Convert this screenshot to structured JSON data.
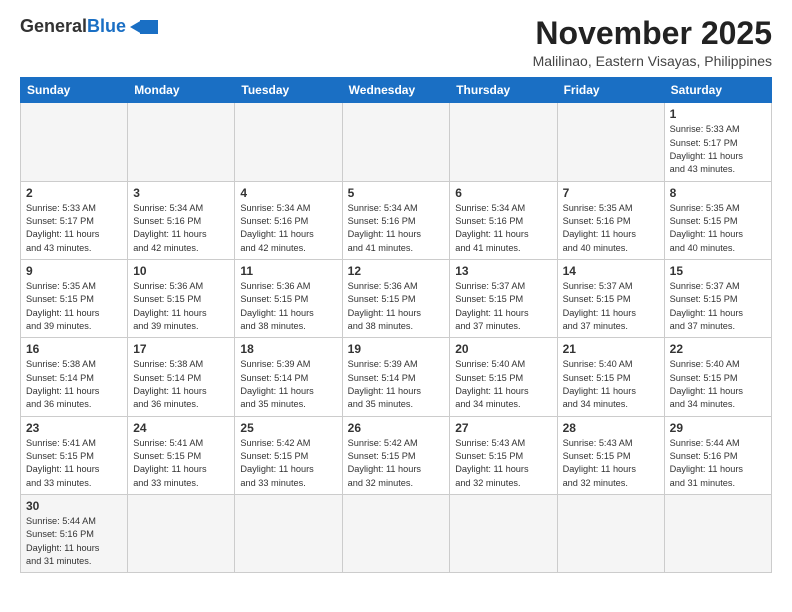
{
  "header": {
    "logo_general": "General",
    "logo_blue": "Blue",
    "month_title": "November 2025",
    "location": "Malilinao, Eastern Visayas, Philippines"
  },
  "weekdays": [
    "Sunday",
    "Monday",
    "Tuesday",
    "Wednesday",
    "Thursday",
    "Friday",
    "Saturday"
  ],
  "weeks": [
    [
      {
        "day": "",
        "info": ""
      },
      {
        "day": "",
        "info": ""
      },
      {
        "day": "",
        "info": ""
      },
      {
        "day": "",
        "info": ""
      },
      {
        "day": "",
        "info": ""
      },
      {
        "day": "",
        "info": ""
      },
      {
        "day": "1",
        "info": "Sunrise: 5:33 AM\nSunset: 5:17 PM\nDaylight: 11 hours\nand 43 minutes."
      }
    ],
    [
      {
        "day": "2",
        "info": "Sunrise: 5:33 AM\nSunset: 5:17 PM\nDaylight: 11 hours\nand 43 minutes."
      },
      {
        "day": "3",
        "info": "Sunrise: 5:34 AM\nSunset: 5:16 PM\nDaylight: 11 hours\nand 42 minutes."
      },
      {
        "day": "4",
        "info": "Sunrise: 5:34 AM\nSunset: 5:16 PM\nDaylight: 11 hours\nand 42 minutes."
      },
      {
        "day": "5",
        "info": "Sunrise: 5:34 AM\nSunset: 5:16 PM\nDaylight: 11 hours\nand 41 minutes."
      },
      {
        "day": "6",
        "info": "Sunrise: 5:34 AM\nSunset: 5:16 PM\nDaylight: 11 hours\nand 41 minutes."
      },
      {
        "day": "7",
        "info": "Sunrise: 5:35 AM\nSunset: 5:16 PM\nDaylight: 11 hours\nand 40 minutes."
      },
      {
        "day": "8",
        "info": "Sunrise: 5:35 AM\nSunset: 5:15 PM\nDaylight: 11 hours\nand 40 minutes."
      }
    ],
    [
      {
        "day": "9",
        "info": "Sunrise: 5:35 AM\nSunset: 5:15 PM\nDaylight: 11 hours\nand 39 minutes."
      },
      {
        "day": "10",
        "info": "Sunrise: 5:36 AM\nSunset: 5:15 PM\nDaylight: 11 hours\nand 39 minutes."
      },
      {
        "day": "11",
        "info": "Sunrise: 5:36 AM\nSunset: 5:15 PM\nDaylight: 11 hours\nand 38 minutes."
      },
      {
        "day": "12",
        "info": "Sunrise: 5:36 AM\nSunset: 5:15 PM\nDaylight: 11 hours\nand 38 minutes."
      },
      {
        "day": "13",
        "info": "Sunrise: 5:37 AM\nSunset: 5:15 PM\nDaylight: 11 hours\nand 37 minutes."
      },
      {
        "day": "14",
        "info": "Sunrise: 5:37 AM\nSunset: 5:15 PM\nDaylight: 11 hours\nand 37 minutes."
      },
      {
        "day": "15",
        "info": "Sunrise: 5:37 AM\nSunset: 5:15 PM\nDaylight: 11 hours\nand 37 minutes."
      }
    ],
    [
      {
        "day": "16",
        "info": "Sunrise: 5:38 AM\nSunset: 5:14 PM\nDaylight: 11 hours\nand 36 minutes."
      },
      {
        "day": "17",
        "info": "Sunrise: 5:38 AM\nSunset: 5:14 PM\nDaylight: 11 hours\nand 36 minutes."
      },
      {
        "day": "18",
        "info": "Sunrise: 5:39 AM\nSunset: 5:14 PM\nDaylight: 11 hours\nand 35 minutes."
      },
      {
        "day": "19",
        "info": "Sunrise: 5:39 AM\nSunset: 5:14 PM\nDaylight: 11 hours\nand 35 minutes."
      },
      {
        "day": "20",
        "info": "Sunrise: 5:40 AM\nSunset: 5:15 PM\nDaylight: 11 hours\nand 34 minutes."
      },
      {
        "day": "21",
        "info": "Sunrise: 5:40 AM\nSunset: 5:15 PM\nDaylight: 11 hours\nand 34 minutes."
      },
      {
        "day": "22",
        "info": "Sunrise: 5:40 AM\nSunset: 5:15 PM\nDaylight: 11 hours\nand 34 minutes."
      }
    ],
    [
      {
        "day": "23",
        "info": "Sunrise: 5:41 AM\nSunset: 5:15 PM\nDaylight: 11 hours\nand 33 minutes."
      },
      {
        "day": "24",
        "info": "Sunrise: 5:41 AM\nSunset: 5:15 PM\nDaylight: 11 hours\nand 33 minutes."
      },
      {
        "day": "25",
        "info": "Sunrise: 5:42 AM\nSunset: 5:15 PM\nDaylight: 11 hours\nand 33 minutes."
      },
      {
        "day": "26",
        "info": "Sunrise: 5:42 AM\nSunset: 5:15 PM\nDaylight: 11 hours\nand 32 minutes."
      },
      {
        "day": "27",
        "info": "Sunrise: 5:43 AM\nSunset: 5:15 PM\nDaylight: 11 hours\nand 32 minutes."
      },
      {
        "day": "28",
        "info": "Sunrise: 5:43 AM\nSunset: 5:15 PM\nDaylight: 11 hours\nand 32 minutes."
      },
      {
        "day": "29",
        "info": "Sunrise: 5:44 AM\nSunset: 5:16 PM\nDaylight: 11 hours\nand 31 minutes."
      }
    ],
    [
      {
        "day": "30",
        "info": "Sunrise: 5:44 AM\nSunset: 5:16 PM\nDaylight: 11 hours\nand 31 minutes."
      },
      {
        "day": "",
        "info": ""
      },
      {
        "day": "",
        "info": ""
      },
      {
        "day": "",
        "info": ""
      },
      {
        "day": "",
        "info": ""
      },
      {
        "day": "",
        "info": ""
      },
      {
        "day": "",
        "info": ""
      }
    ]
  ]
}
